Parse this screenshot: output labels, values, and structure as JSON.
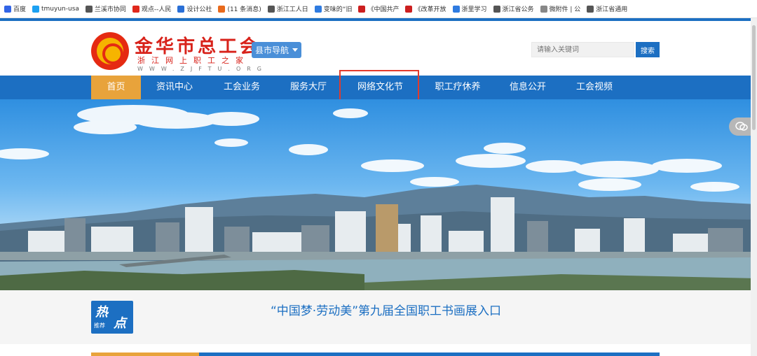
{
  "bookmarks": [
    {
      "label": "百度",
      "color": "#3264e6"
    },
    {
      "label": "tmuyun-usa",
      "color": "#1da1f2"
    },
    {
      "label": "兰溪市协同",
      "color": "#555555"
    },
    {
      "label": "观点--人民",
      "color": "#e0281b"
    },
    {
      "label": "设计公社",
      "color": "#2a6fd6"
    },
    {
      "label": "(11 条消息)",
      "color": "#e86a1c"
    },
    {
      "label": "浙江工人日",
      "color": "#555555"
    },
    {
      "label": "变味的“旧",
      "color": "#2f7be0"
    },
    {
      "label": "《中国共产",
      "color": "#cc1f1f"
    },
    {
      "label": "《改革开放",
      "color": "#cc1f1f"
    },
    {
      "label": "浙里学习",
      "color": "#2f7be0"
    },
    {
      "label": "浙江省公务",
      "color": "#555555"
    },
    {
      "label": "微附件 | 公",
      "color": "#888888"
    },
    {
      "label": "浙江省通用",
      "color": "#555555"
    }
  ],
  "header": {
    "logo_title": "金华市总工会",
    "logo_subtitle": "浙江网上职工之家",
    "logo_url": "WWW.ZJFTU.ORG",
    "county_nav_label": "县市导航",
    "search_placeholder": "请输入关键词",
    "search_button": "搜索"
  },
  "nav": {
    "items": [
      "首页",
      "资讯中心",
      "工会业务",
      "服务大厅",
      "网络文化节",
      "职工疗休养",
      "信息公开",
      "工会视频"
    ],
    "active_index": 0,
    "highlighted_index": 4
  },
  "hot": {
    "badge_char1": "热",
    "badge_char2": "点",
    "badge_sub": "推荐",
    "headline": "“中国梦·劳动美”第九届全国职工书画展入口"
  },
  "colors": {
    "primary": "#1c6fc2",
    "active": "#e8a33b",
    "highlight_border": "#e23a2c",
    "logo_red": "#d8221a"
  }
}
